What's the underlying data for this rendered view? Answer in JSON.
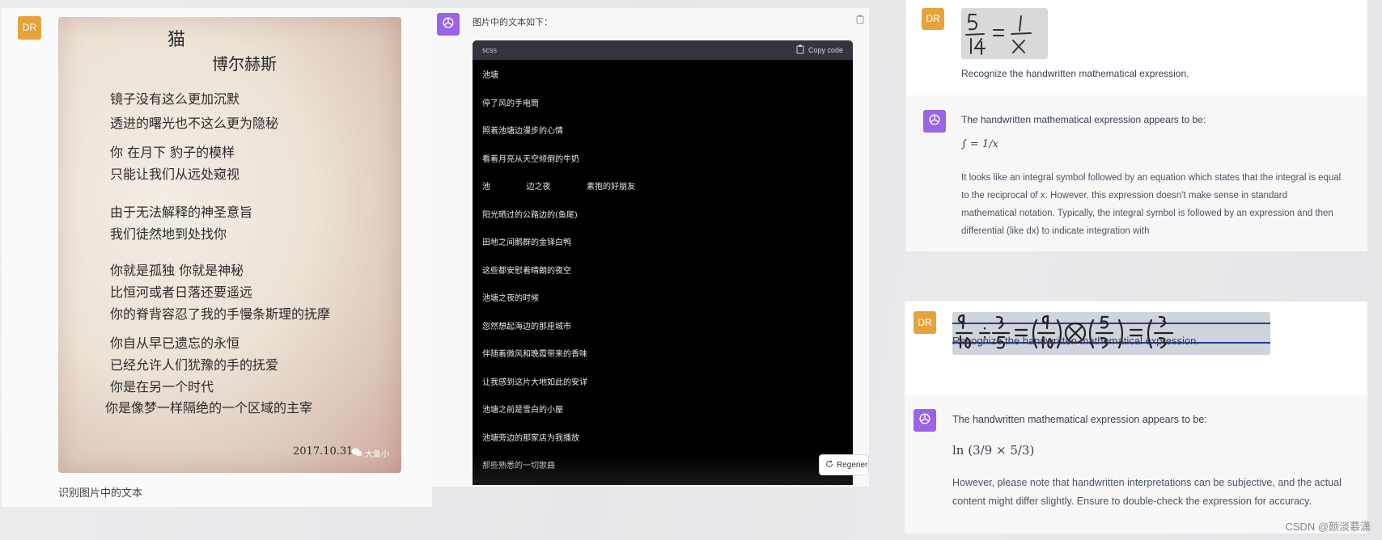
{
  "panel1": {
    "avatar": "DR",
    "photo_poem": {
      "title": "猫",
      "author": "博尔赫斯",
      "lines": [
        "镜子没有这么更加沉默",
        "透进的曙光也不这么更为隐秘",
        "你    在月下    豹子的模样",
        "只能让我们从远处窥视",
        "由于无法解释的神圣意旨",
        "我们徒然地到处找你",
        "你就是孤独    你就是神秘",
        "比恒河或者日落还要遥远",
        "你的脊背容忍了我的手慢条斯理的抚摩",
        "你自从早已遗忘的永恒",
        "已经允许人们犹豫的手的抚爱",
        "你是在另一个时代",
        "你是像梦一样隔绝的一个区域的主宰"
      ],
      "date": "2017.10.31",
      "watermark": "大鱼小"
    },
    "caption": "识别图片中的文本"
  },
  "panel2": {
    "intro": "图片中的文本如下：",
    "code": {
      "language": "scss",
      "copy_label": "Copy code",
      "lines": [
        "池塘",
        "停了风的手电筒",
        "照着池塘边漫步的心情",
        "看着月亮从天空倾倒的牛奶",
        "池              边之夜              素抱的好朋友",
        "阳光晒过的公路边的(鱼尾)",
        "田地之间鹅群的金铎白鸭",
        "这些都安慰着晴朗的夜空",
        "池塘之夜的时候",
        "忽然想起海边的那座城市",
        "伴随着微风和晚霞带来的香味",
        "让我感到这片大地如此的安详",
        "池塘之前是雪白的小屋",
        "池塘旁边的那家店为我播放",
        "那些熟悉的一切歌曲"
      ]
    },
    "regenerate_label": "Regenera"
  },
  "panel3": {
    "avatar": "DR",
    "handwriting": "5/14 = 1/x",
    "prompt": "Recognize the handwritten mathematical expression.",
    "answer_intro": "The handwritten mathematical expression appears to be:",
    "formula": "∫ = 1/x",
    "explanation_lines": [
      "It looks like an integral symbol followed by an equation which states that the integral is equal",
      "to the reciprocal of x. However, this expression doesn't make sense in standard",
      "mathematical notation. Typically, the integral symbol is followed by an expression and then",
      "differential (like dx) to indicate integration with"
    ]
  },
  "panel4": {
    "avatar": "DR",
    "handwriting": "9/10 ÷ 3/5 = (9/10) × (5/3) = (3/3",
    "prompt": "Recognize the handwritten mathematical expression.",
    "answer_intro": "The handwritten mathematical expression appears to be:",
    "formula": "ln (3/9 × 5/3)",
    "note_lines": [
      "However, please note that handwritten interpretations can be subjective, and the actual",
      "content might differ slightly. Ensure to double-check the expression for accuracy."
    ]
  },
  "watermark": "CSDN @颜淡慕潇",
  "colors": {
    "user_avatar": "#e8a23c",
    "gpt_avatar": "#9a63e8",
    "code_bg": "#000000",
    "code_header": "#343541"
  },
  "icons": [
    "openai-logo-icon",
    "clipboard-icon",
    "refresh-icon",
    "wechat-icon"
  ]
}
